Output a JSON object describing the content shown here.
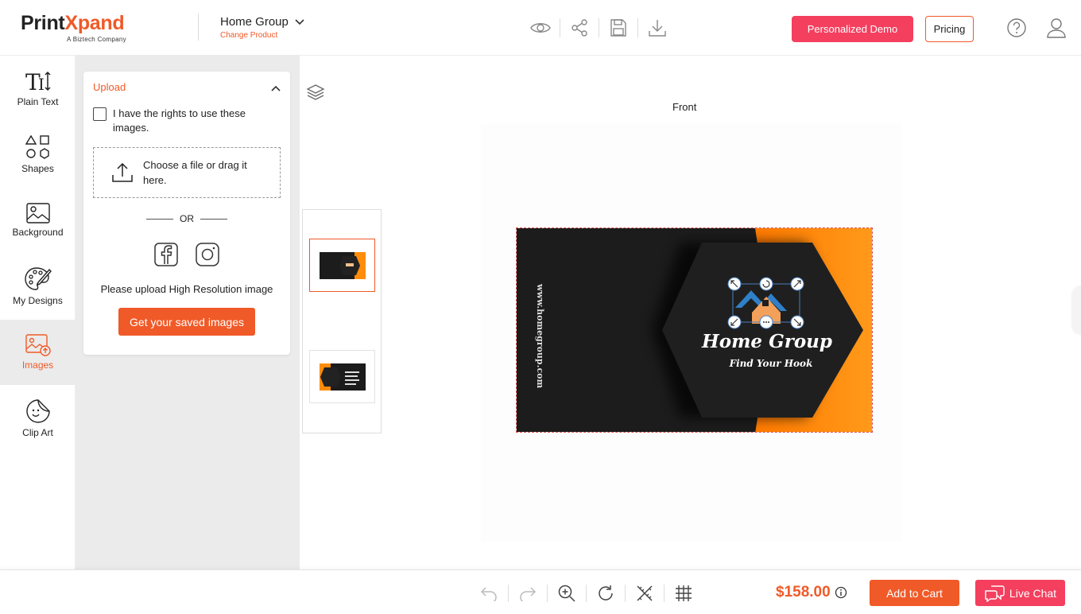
{
  "header": {
    "logo_main_a": "Print",
    "logo_main_b": "Xpand",
    "logo_sub": "A Biztech Company",
    "product_name": "Home Group",
    "change_product": "Change Product",
    "demo_button": "Personalized Demo",
    "pricing_button": "Pricing",
    "icons": [
      "eye-icon",
      "share-icon",
      "save-icon",
      "download-icon",
      "help-icon",
      "user-icon"
    ]
  },
  "tools": [
    {
      "label": "Plain Text",
      "icon": "text-icon"
    },
    {
      "label": "Shapes",
      "icon": "shapes-icon"
    },
    {
      "label": "Background",
      "icon": "image-icon"
    },
    {
      "label": "My Designs",
      "icon": "palette-icon"
    },
    {
      "label": "Images",
      "icon": "images-icon",
      "active": true
    },
    {
      "label": "Clip Art",
      "icon": "sticker-icon"
    }
  ],
  "upload_panel": {
    "title": "Upload",
    "rights_text": "I have the rights to use these images.",
    "dropzone_text": "Choose a file or drag it here.",
    "or_text": "OR",
    "note": "Please upload High Resolution image",
    "saved_button": "Get your saved images"
  },
  "canvas": {
    "side_label": "Front",
    "card": {
      "vertical_url": "www.homegroup.com",
      "title": "Home Group",
      "tagline": "Find Your Hook"
    },
    "colors": {
      "accent": "#f05a28",
      "card_dark": "#1c1c1c",
      "card_orange": "#ff8c0a",
      "logo_blue": "#2f80c9"
    }
  },
  "footer": {
    "price": "$158.00",
    "add_to_cart": "Add to Cart",
    "live_chat": "Live Chat",
    "icons": [
      "undo-icon",
      "redo-icon",
      "zoom-in-icon",
      "refresh-icon",
      "pencil-ruler-icon",
      "grid-icon"
    ]
  }
}
